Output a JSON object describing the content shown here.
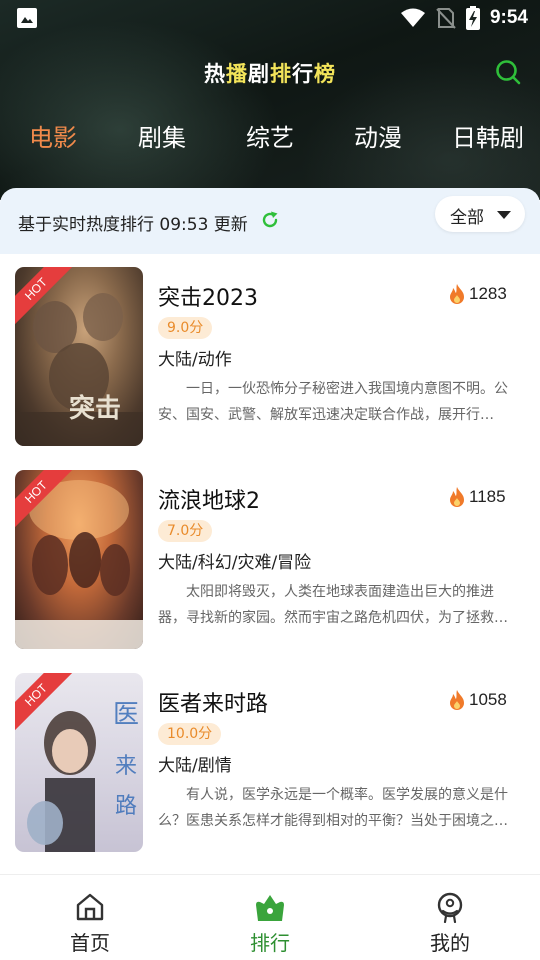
{
  "status_bar": {
    "time": "9:54"
  },
  "header": {
    "title_parts": [
      "热",
      "播",
      "剧",
      "排",
      "行",
      "榜"
    ]
  },
  "tabs": [
    {
      "label": "电影",
      "active": true
    },
    {
      "label": "剧集",
      "active": false
    },
    {
      "label": "综艺",
      "active": false
    },
    {
      "label": "动漫",
      "active": false
    },
    {
      "label": "日韩剧",
      "active": false
    }
  ],
  "info_bar": {
    "text": "基于实时热度排行 09:53 更新",
    "filter_label": "全部"
  },
  "items": [
    {
      "title": "突击2023",
      "heat": "1283",
      "score": "9.0分",
      "genre": "大陆/动作",
      "badge": "HOT",
      "description": "一日，一伙恐怖分子秘密进入我国境内意图不明。公安、国安、武警、解放军迅速决定联合作战，展开行动……"
    },
    {
      "title": "流浪地球2",
      "heat": "1185",
      "score": "7.0分",
      "genre": "大陆/科幻/灾难/冒险",
      "badge": "HOT",
      "description": "太阳即将毁灭，人类在地球表面建造出巨大的推进器，寻找新的家园。然而宇宙之路危机四伏，为了拯救地球……"
    },
    {
      "title": "医者来时路",
      "heat": "1058",
      "score": "10.0分",
      "genre": "大陆/剧情",
      "badge": "HOT",
      "description": "有人说，医学永远是一个概率。医学发展的意义是什么？医患关系怎样才能得到相对的平衡？当处于困境之中……"
    }
  ],
  "bottom_nav": [
    {
      "label": "首页",
      "icon": "home-icon",
      "active": false
    },
    {
      "label": "排行",
      "icon": "ranking-icon",
      "active": true
    },
    {
      "label": "我的",
      "icon": "profile-icon",
      "active": false
    }
  ],
  "colors": {
    "accent_orange": "#f08a4b",
    "active_green": "#2e8f31",
    "hot_red": "#e53d3d",
    "score_bg": "#fdebd5",
    "info_bar_bg": "#ebf3fb"
  }
}
